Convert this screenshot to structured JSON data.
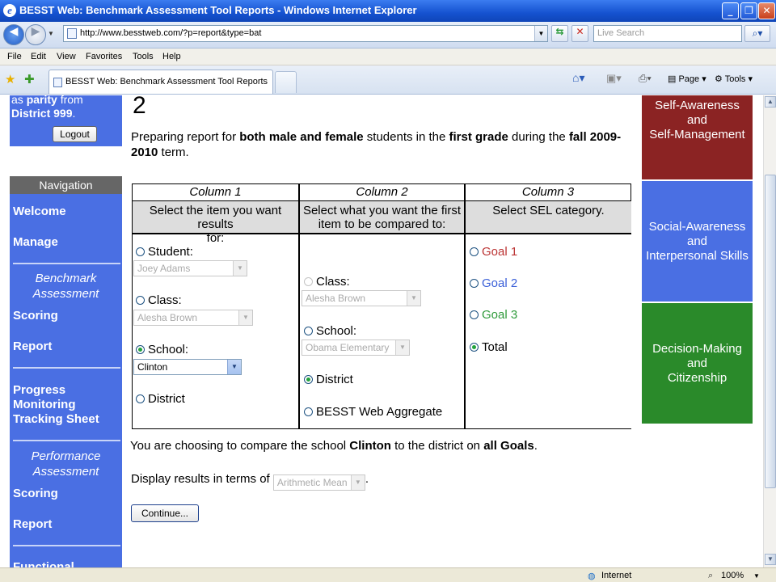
{
  "window": {
    "title": "BESST Web: Benchmark Assessment Tool Reports - Windows Internet Explorer",
    "minimize": "_",
    "maximize": "❐",
    "close": "✕"
  },
  "address": {
    "url": "http://www.besstweb.com/?p=report&type=bat",
    "search_placeholder": "Live Search"
  },
  "menu": [
    "File",
    "Edit",
    "View",
    "Favorites",
    "Tools",
    "Help"
  ],
  "tab": {
    "label": "BESST Web: Benchmark Assessment Tool Reports"
  },
  "toolbar": {
    "page_label": "Page",
    "tools_label": "Tools"
  },
  "user": {
    "line1_prefix": "as ",
    "line1_bold": "parity",
    "line1_suffix": " from",
    "district": "District 999",
    "district_suffix": ".",
    "logout_label": "Logout"
  },
  "nav": {
    "heading": "Navigation",
    "welcome": "Welcome",
    "manage": "Manage",
    "bench_line1": "Benchmark",
    "bench_line2": "Assessment",
    "bench_scoring": "Scoring",
    "bench_report": "Report",
    "progress_line1": "Progress",
    "progress_line2": "Monitoring",
    "progress_line3": "Tracking Sheet",
    "perf_line1": "Performance",
    "perf_line2": "Assessment",
    "perf_scoring": "Scoring",
    "perf_report": "Report",
    "cut_off": "Functional"
  },
  "main": {
    "step_number": "2",
    "prep_1": "Preparing report for ",
    "prep_b1": "both male and female",
    "prep_2": " students in the ",
    "prep_b2": "first grade",
    "prep_3": " during the ",
    "prep_b3": "fall 2009-2010",
    "prep_4": " term."
  },
  "columns": {
    "c1": {
      "title": "Column 1",
      "sub_line1": "Select the item you want results",
      "sub_line2": "for:"
    },
    "c2": {
      "title": "Column 2",
      "sub_line1": "Select what you want the first",
      "sub_line2": "item to be compared to:"
    },
    "c3": {
      "title": "Column 3",
      "sub_line1": "Select SEL category.",
      "sub_line2": ""
    }
  },
  "col1": {
    "student_label": "Student:",
    "student_value": "Joey Adams",
    "class_label": "Class:",
    "class_value": "Alesha Brown",
    "school_label": "School:",
    "school_value": "Clinton",
    "district_label": "District",
    "selected": "School"
  },
  "col2": {
    "class_label": "Class:",
    "class_value": "Alesha Brown",
    "school_label": "School:",
    "school_value": "Obama Elementary",
    "district_label": "District",
    "aggregate_label": "BESST Web Aggregate",
    "selected": "District"
  },
  "col3": {
    "goal1": "Goal 1",
    "goal2": "Goal 2",
    "goal3": "Goal 3",
    "total": "Total",
    "selected": "Total"
  },
  "summary": {
    "prefix": "You are choosing to compare the school ",
    "school": "Clinton",
    "middle": " to the district on ",
    "scope": "all Goals",
    "suffix": "."
  },
  "display": {
    "prefix": "Display results in terms of ",
    "value": "Arithmetic Mean",
    "suffix": "."
  },
  "continue_label": "Continue...",
  "categories": {
    "cat1": [
      "Self-Awareness",
      "and",
      "Self-Management"
    ],
    "cat2": [
      "Social-Awareness",
      "and",
      "Interpersonal Skills"
    ],
    "cat3": [
      "Decision-Making",
      "and",
      "Citizenship"
    ]
  },
  "colors": {
    "nav_blue": "#4a6fe3",
    "cat1": "#8b2323",
    "cat2": "#4a6fe3",
    "cat3": "#2a8a2a",
    "goal1": "#b33333",
    "goal2": "#3a5fd8",
    "goal3": "#2e9a3a"
  },
  "status": {
    "zone": "Internet",
    "zoom": "100%"
  }
}
